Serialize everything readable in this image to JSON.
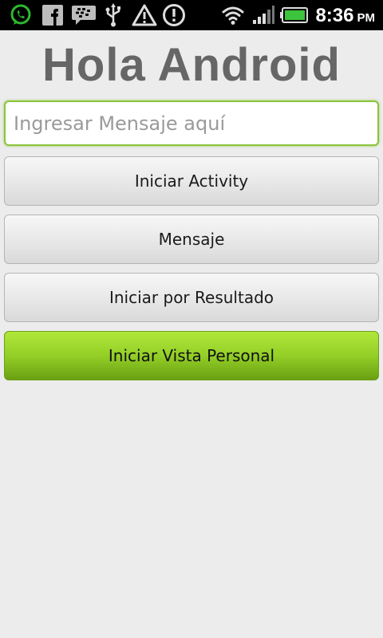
{
  "status_bar": {
    "icons": [
      "whatsapp-icon",
      "facebook-icon",
      "bbm-icon",
      "usb-icon",
      "warning-triangle-icon",
      "alert-circle-icon",
      "wifi-icon",
      "signal-icon",
      "battery-icon"
    ],
    "time": "8:36",
    "ampm": "PM"
  },
  "app": {
    "title": "Hola Android"
  },
  "message_input": {
    "value": "",
    "placeholder": "Ingresar Mensaje aquí"
  },
  "buttons": {
    "start_activity": "Iniciar Activity",
    "message": "Mensaje",
    "start_for_result": "Iniciar por Resultado",
    "start_custom_view": "Iniciar Vista Personal"
  },
  "colors": {
    "title": "#666666",
    "accent_green": "#8bc43c",
    "background": "#ececec"
  }
}
